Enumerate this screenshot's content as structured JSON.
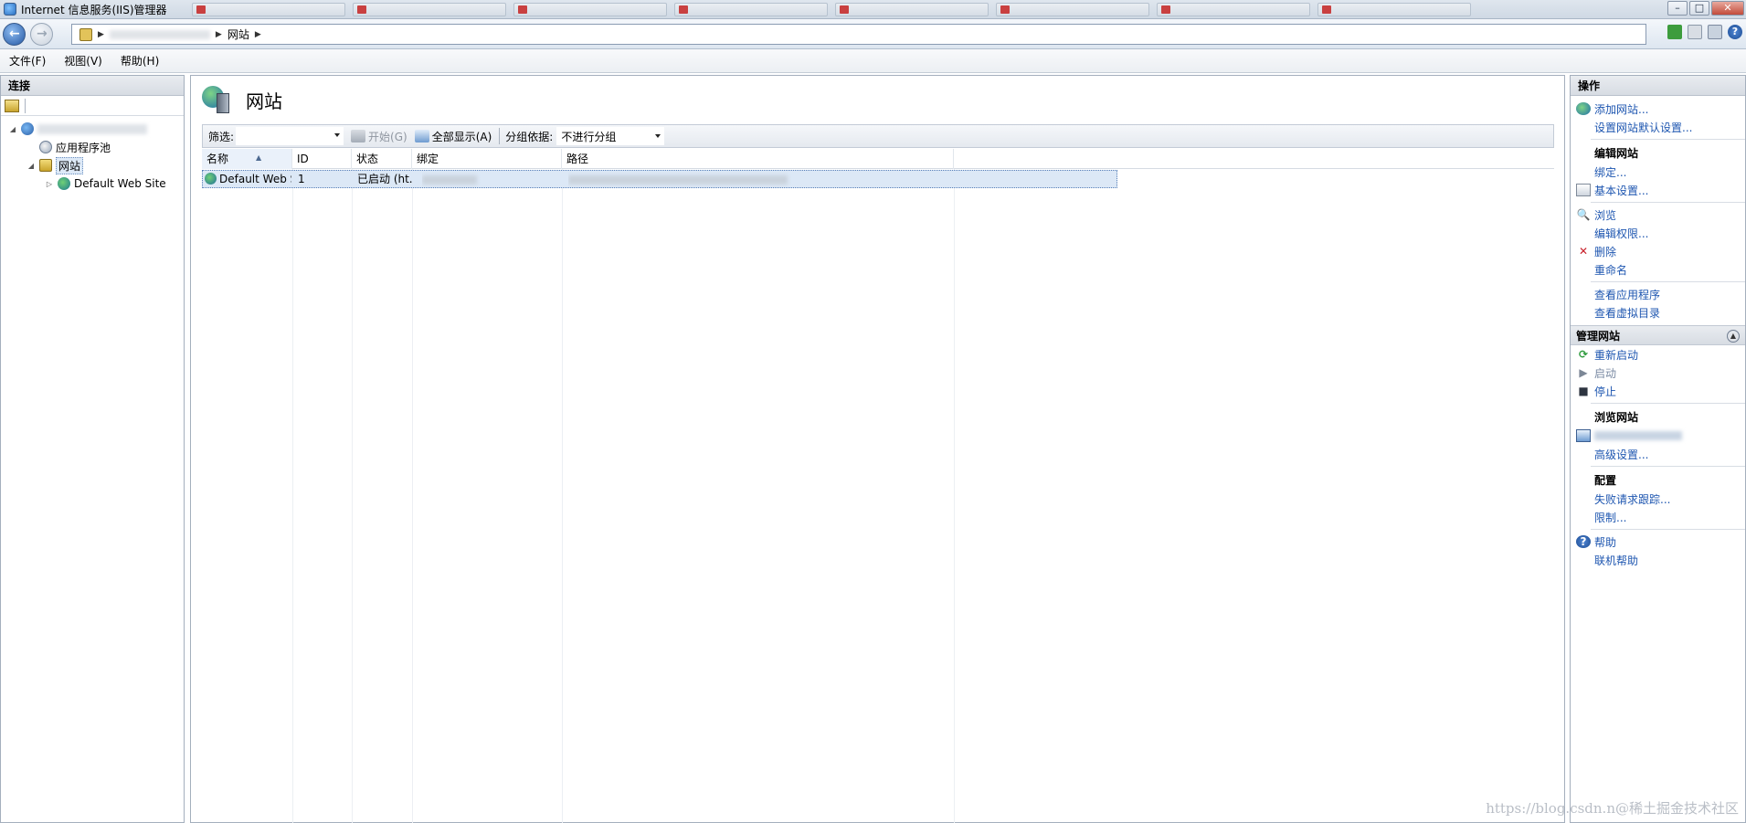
{
  "window": {
    "title": "Internet 信息服务(IIS)管理器"
  },
  "address": {
    "crumb": "网站"
  },
  "menus": [
    "文件(F)",
    "视图(V)",
    "帮助(H)"
  ],
  "connections": {
    "title": "连接",
    "tree": [
      {
        "label": "应用程序池"
      },
      {
        "label": "网站"
      },
      {
        "label": "Default Web Site"
      }
    ]
  },
  "main": {
    "page_title": "网站",
    "filter": {
      "label": "筛选:",
      "go_label": "开始(G)",
      "show_all_label": "全部显示(A)",
      "group_label": "分组依据:",
      "group_value": "不进行分组"
    },
    "columns": [
      "名称",
      "ID",
      "状态",
      "绑定",
      "路径"
    ],
    "rows": [
      {
        "name": "Default Web S...",
        "id": "1",
        "status": "已启动 (ht..."
      }
    ]
  },
  "actions": {
    "title": "操作",
    "add_site": "添加网站...",
    "site_defaults": "设置网站默认设置...",
    "edit_site_group": "编辑网站",
    "bindings": "绑定...",
    "basic_settings": "基本设置...",
    "browse": "浏览",
    "edit_permissions": "编辑权限...",
    "delete": "删除",
    "rename": "重命名",
    "view_apps": "查看应用程序",
    "view_vdirs": "查看虚拟目录",
    "manage_site_section": "管理网站",
    "restart": "重新启动",
    "start": "启动",
    "stop": "停止",
    "browse_site_group": "浏览网站",
    "advanced_settings": "高级设置...",
    "config_group": "配置",
    "failed_tracing": "失败请求跟踪...",
    "limits": "限制...",
    "help": "帮助",
    "online_help": "联机帮助"
  },
  "watermark": "https://blog.csdn.n@稀土掘金技术社区"
}
